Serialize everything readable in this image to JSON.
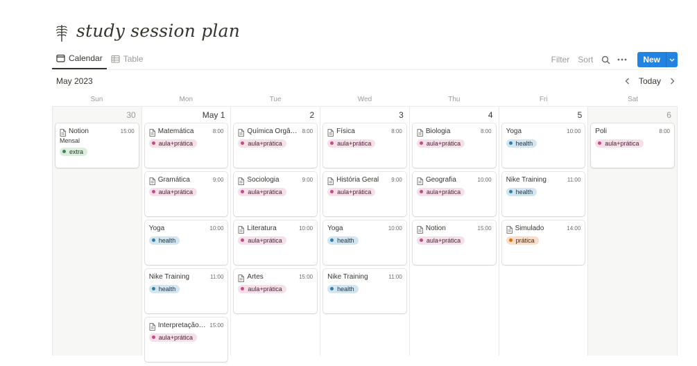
{
  "page": {
    "title": "study session plan",
    "icon": "fern-leaf-icon"
  },
  "tabs": [
    {
      "label": "Calendar",
      "icon": "calendar-icon",
      "active": true
    },
    {
      "label": "Table",
      "icon": "table-icon",
      "active": false
    }
  ],
  "toolbar": {
    "filter": "Filter",
    "sort": "Sort",
    "search_icon": "search-icon",
    "more_icon": "more-icon",
    "new_label": "New",
    "new_dropdown_icon": "chevron-down-icon"
  },
  "calendar": {
    "month": "May 2023",
    "today_label": "Today",
    "weekdays": [
      "Sun",
      "Mon",
      "Tue",
      "Wed",
      "Thu",
      "Fri",
      "Sat"
    ],
    "days": [
      {
        "label": "30",
        "weekend": true,
        "events": [
          {
            "title": "Notion",
            "time": "15:00",
            "sub": "Mensal",
            "tag": "extra"
          }
        ]
      },
      {
        "label": "May 1",
        "weekend": false,
        "events": [
          {
            "title": "Matemática",
            "time": "8:00",
            "tag": "aula+prática"
          },
          {
            "title": "Gramática",
            "time": "9:00",
            "tag": "aula+prática"
          },
          {
            "title": "Yoga",
            "time": "10:00",
            "tag": "health",
            "noIcon": true
          },
          {
            "title": "Nike Training",
            "time": "11:00",
            "tag": "health",
            "noIcon": true
          },
          {
            "title": "Interpretação + ...",
            "time": "15:00",
            "tag": "aula+prática"
          }
        ]
      },
      {
        "label": "2",
        "weekend": false,
        "events": [
          {
            "title": "Química Orgânica",
            "time": "8:00",
            "tag": "aula+prática"
          },
          {
            "title": "Sociologia",
            "time": "9:00",
            "tag": "aula+prática"
          },
          {
            "title": "Literatura",
            "time": "10:00",
            "tag": "aula+prática"
          },
          {
            "title": "Artes",
            "time": "15:00",
            "tag": "aula+prática"
          }
        ]
      },
      {
        "label": "3",
        "weekend": false,
        "events": [
          {
            "title": "Física",
            "time": "8:00",
            "tag": "aula+prática"
          },
          {
            "title": "História Geral",
            "time": "9:00",
            "tag": "aula+prática"
          },
          {
            "title": "Yoga",
            "time": "10:00",
            "tag": "health",
            "noIcon": true
          },
          {
            "title": "Nike Training",
            "time": "11:00",
            "tag": "health",
            "noIcon": true
          }
        ]
      },
      {
        "label": "4",
        "weekend": false,
        "events": [
          {
            "title": "Biologia",
            "time": "8:00",
            "tag": "aula+prática"
          },
          {
            "title": "Geografia",
            "time": "10:00",
            "tag": "aula+prática"
          },
          {
            "title": "Notion",
            "time": "15:00",
            "tag": "aula+prática"
          }
        ]
      },
      {
        "label": "5",
        "weekend": false,
        "events": [
          {
            "title": "Yoga",
            "time": "10:00",
            "tag": "health",
            "noIcon": true
          },
          {
            "title": "Nike Training",
            "time": "11:00",
            "tag": "health",
            "noIcon": true
          },
          {
            "title": "Simulado",
            "time": "14:00",
            "tag": "prática"
          }
        ]
      },
      {
        "label": "6",
        "weekend": true,
        "events": [
          {
            "title": "Poli",
            "time": "8:00",
            "tag": "aula+prática",
            "noIcon": true
          }
        ]
      }
    ]
  },
  "tag_styles": {
    "aula+prática": {
      "bg": "#f5e0e9",
      "dot": "#c14c8a",
      "text": "#4c2337"
    },
    "health": {
      "bg": "#d3e5ef",
      "dot": "#337ea9",
      "text": "#183347"
    },
    "extra": {
      "bg": "#dbeddb",
      "dot": "#448361",
      "text": "#1c3829"
    },
    "prática": {
      "bg": "#fadec9",
      "dot": "#d9730d",
      "text": "#49290e"
    }
  },
  "colors": {
    "accent": "#2383e2",
    "weekend_bg": "#f7f7f5"
  }
}
